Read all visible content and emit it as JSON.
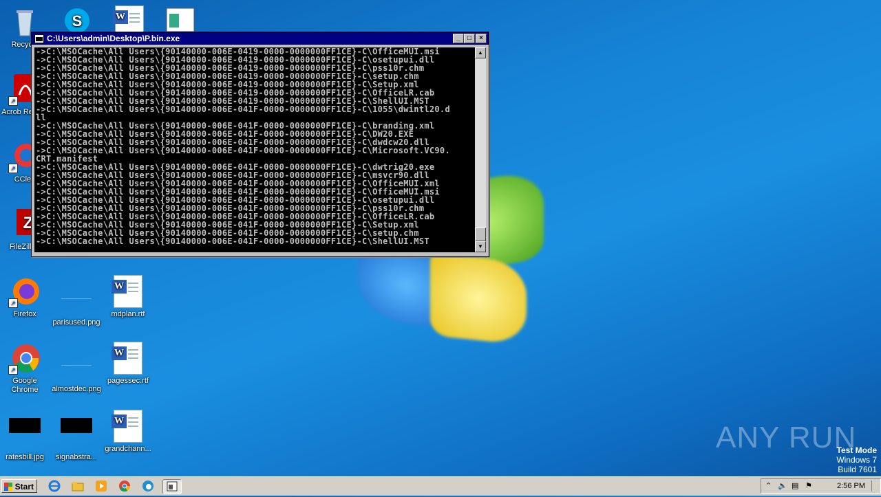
{
  "window": {
    "title": "C:\\Users\\admin\\Desktop\\P.bin.exe",
    "console_lines": [
      "->C:\\MSOCache\\All Users\\{90140000-006E-0419-0000-0000000FF1CE}-C\\OfficeMUI.msi",
      "->C:\\MSOCache\\All Users\\{90140000-006E-0419-0000-0000000FF1CE}-C\\osetupui.dll",
      "->C:\\MSOCache\\All Users\\{90140000-006E-0419-0000-0000000FF1CE}-C\\pss10r.chm",
      "->C:\\MSOCache\\All Users\\{90140000-006E-0419-0000-0000000FF1CE}-C\\setup.chm",
      "->C:\\MSOCache\\All Users\\{90140000-006E-0419-0000-0000000FF1CE}-C\\Setup.xml",
      "->C:\\MSOCache\\All Users\\{90140000-006E-0419-0000-0000000FF1CE}-C\\OfficeLR.cab",
      "->C:\\MSOCache\\All Users\\{90140000-006E-0419-0000-0000000FF1CE}-C\\ShellUI.MST",
      "->C:\\MSOCache\\All Users\\{90140000-006E-041F-0000-0000000FF1CE}-C\\1055\\dwintl20.d",
      "ll",
      "->C:\\MSOCache\\All Users\\{90140000-006E-041F-0000-0000000FF1CE}-C\\branding.xml",
      "->C:\\MSOCache\\All Users\\{90140000-006E-041F-0000-0000000FF1CE}-C\\DW20.EXE",
      "->C:\\MSOCache\\All Users\\{90140000-006E-041F-0000-0000000FF1CE}-C\\dwdcw20.dll",
      "->C:\\MSOCache\\All Users\\{90140000-006E-041F-0000-0000000FF1CE}-C\\Microsoft.VC90.",
      "CRT.manifest",
      "->C:\\MSOCache\\All Users\\{90140000-006E-041F-0000-0000000FF1CE}-C\\dwtrig20.exe",
      "->C:\\MSOCache\\All Users\\{90140000-006E-041F-0000-0000000FF1CE}-C\\msvcr90.dll",
      "->C:\\MSOCache\\All Users\\{90140000-006E-041F-0000-0000000FF1CE}-C\\OfficeMUI.xml",
      "->C:\\MSOCache\\All Users\\{90140000-006E-041F-0000-0000000FF1CE}-C\\OfficeMUI.msi",
      "->C:\\MSOCache\\All Users\\{90140000-006E-041F-0000-0000000FF1CE}-C\\osetupui.dll",
      "->C:\\MSOCache\\All Users\\{90140000-006E-041F-0000-0000000FF1CE}-C\\pss10r.chm",
      "->C:\\MSOCache\\All Users\\{90140000-006E-041F-0000-0000000FF1CE}-C\\OfficeLR.cab",
      "->C:\\MSOCache\\All Users\\{90140000-006E-041F-0000-0000000FF1CE}-C\\Setup.xml",
      "->C:\\MSOCache\\All Users\\{90140000-006E-041F-0000-0000000FF1CE}-C\\setup.chm",
      "->C:\\MSOCache\\All Users\\{90140000-006E-041F-0000-0000000FF1CE}-C\\ShellUI.MST"
    ]
  },
  "desktop_icons": {
    "recycle": "Recycle",
    "acrobat": "Acrob Reader",
    "ccleaner": "CClea",
    "filezilla": "FileZilla (",
    "firefox": "Firefox",
    "parisused": "parisused.png",
    "mdplan": "mdplan.rtf",
    "chrome": "Google Chrome",
    "almostdec": "almostdec.png",
    "pagessec": "pagessec.rtf",
    "ratesbill": "ratesbill.jpg",
    "signabstra": "signabstra...",
    "grandchann": "grandchann..."
  },
  "taskbar": {
    "start_label": "Start",
    "clock": "2:56 PM"
  },
  "watermark": "ANY RUN",
  "test_mode": {
    "line1": "Test Mode",
    "line2": "Windows 7",
    "line3": "Build 7601"
  },
  "colors": {
    "titlebar": "#000080",
    "console_bg": "#000000",
    "console_fg": "#c0c0c0"
  }
}
